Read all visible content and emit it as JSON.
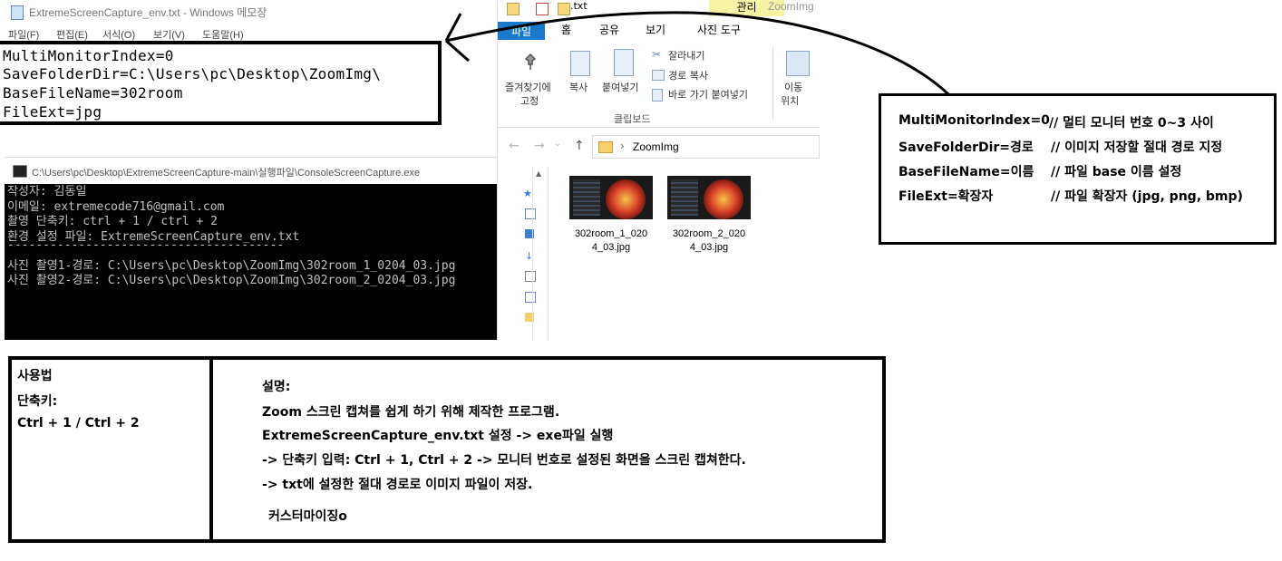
{
  "notepad": {
    "title": "ExtremeScreenCapture_env.txt - Windows 메모장",
    "menu": [
      "파일(F)",
      "편집(E)",
      "서식(O)",
      "보기(V)",
      "도움말(H)"
    ],
    "lines": [
      "MultiMonitorIndex=0",
      "SaveFolderDir=C:\\Users\\pc\\Desktop\\ZoomImg\\",
      "BaseFileName=302room",
      "FileExt=jpg"
    ]
  },
  "console": {
    "title": "C:\\Users\\pc\\Desktop\\ExtremeScreenCapture-main\\실행파일\\ConsoleScreenCapture.exe",
    "lines": [
      "작성자: 김동일",
      "이메일: extremecode716@gmail.com",
      "촬영 단축키: ctrl + 1 / ctrl + 2",
      "환경 설정 파일: ExtremeScreenCapture_env.txt",
      "---------------------------------------",
      "사진 촬영1-경로: C:\\Users\\pc\\Desktop\\ZoomImg\\302room_1_0204_03.jpg",
      "사진 촬영2-경로: C:\\Users\\pc\\Desktop\\ZoomImg\\302room_2_0204_03.jpg"
    ]
  },
  "explorer": {
    "manage_tab": "관리",
    "window_title": "ZoomImg",
    "tabs": [
      "파일",
      "홈",
      "공유",
      "보기",
      "사진 도구"
    ],
    "ribbon": {
      "pin": "즐겨찾기에",
      "pin2": "고정",
      "copy": "복사",
      "paste": "붙여넣기",
      "cut": "잘라내기",
      "copy_path": "경로 복사",
      "paste_shortcut": "바로 가기 붙여넣기",
      "move": "이동",
      "move2": "위치",
      "group": "클립보드"
    },
    "breadcrumb": "ZoomImg",
    "files": [
      {
        "name_line1": "302room_1_020",
        "name_line2": "4_03.jpg"
      },
      {
        "name_line1": "302room_2_020",
        "name_line2": "4_03.jpg"
      }
    ]
  },
  "legend": {
    "lines": [
      {
        "key": "MultiMonitorIndex=0",
        "comment": "// 멀티 모니터 번호 0~3 사이"
      },
      {
        "key": "SaveFolderDir=경로",
        "comment": "// 이미지 저장할 절대 경로 지정"
      },
      {
        "key": "BaseFileName=이름",
        "comment": "// 파일 base 이름 설정"
      },
      {
        "key": "FileExt=확장자",
        "comment": "// 파일 확장자 (jpg, png, bmp)"
      }
    ]
  },
  "usage": {
    "left": [
      "사용법",
      "단축키:",
      "Ctrl + 1 / Ctrl + 2"
    ],
    "right": [
      "설명:",
      "Zoom 스크린 캡쳐를 쉽게 하기 위해 제작한 프로그램.",
      "ExtremeScreenCapture_env.txt 설정 -> exe파일 실행",
      "-> 단축키 입력: Ctrl + 1, Ctrl + 2 -> 모니터 번호로 설정된 화면을 스크린 캡쳐한다.",
      "-> txt에 설정한 절대 경로로 이미지 파일이 저장.",
      "커스터마이징o"
    ]
  }
}
